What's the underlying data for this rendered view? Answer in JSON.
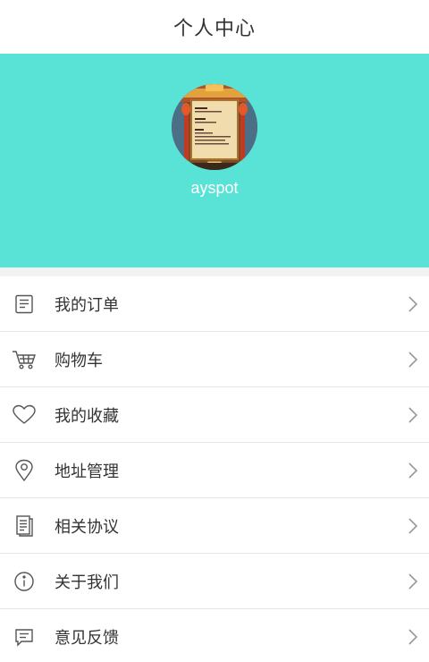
{
  "header": {
    "title": "个人中心"
  },
  "profile": {
    "username": "ayspot",
    "avatar_icon": "avatar-image",
    "background_color": "#58e3d6"
  },
  "menu": {
    "items": [
      {
        "label": "我的订单",
        "icon": "order-list-icon"
      },
      {
        "label": "购物车",
        "icon": "shopping-cart-icon"
      },
      {
        "label": "我的收藏",
        "icon": "heart-icon"
      },
      {
        "label": "地址管理",
        "icon": "location-pin-icon"
      },
      {
        "label": "相关协议",
        "icon": "document-icon"
      },
      {
        "label": "关于我们",
        "icon": "info-icon"
      },
      {
        "label": "意见反馈",
        "icon": "feedback-icon"
      }
    ]
  }
}
